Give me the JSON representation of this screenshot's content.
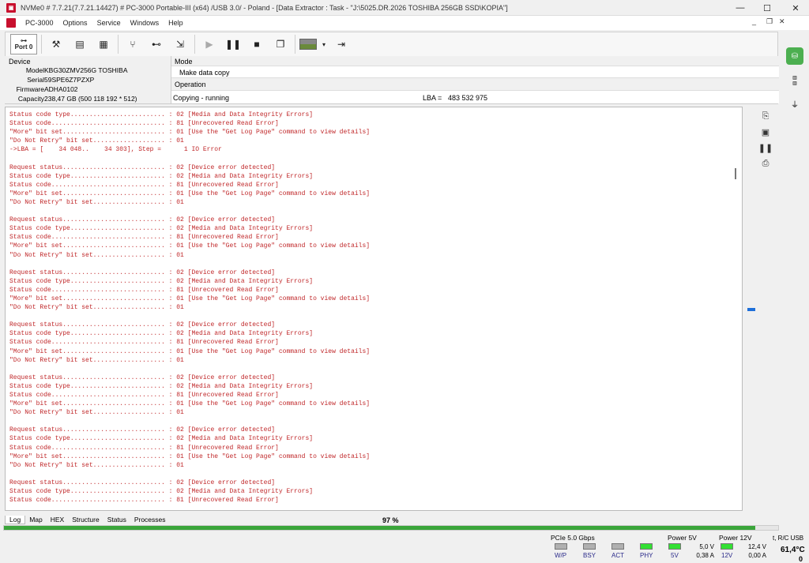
{
  "window": {
    "title": "NVMe0 # 7.7.21(7.7.21.14427) # PC-3000 Portable-III (x64) /USB 3.0/ - Poland - [Data Extractor : Task - \"J:\\5025.DR.2026 TOSHIBA 256GB SSD\\KOPIA\"]",
    "min": "—",
    "max": "☐",
    "close": "✕"
  },
  "menu": [
    "PC-3000",
    "Options",
    "Service",
    "Windows",
    "Help"
  ],
  "mdi": {
    "min": "_",
    "restore": "❐",
    "close": "✕"
  },
  "toolbar": {
    "port_label": "Port 0"
  },
  "device": {
    "heading": "Device",
    "rows": [
      {
        "label": "Model",
        "value": "KBG30ZMV256G TOSHIBA"
      },
      {
        "label": "Serial",
        "value": "59SPE6Z7PZXP"
      },
      {
        "label": "Firmware",
        "value": "ADHA0102"
      },
      {
        "label": "Capacity",
        "value": "238,47 GB (500 118 192 * 512)"
      }
    ]
  },
  "mode": {
    "heading": "Mode",
    "value": "Make data copy"
  },
  "operation": {
    "heading": "Operation",
    "value": "Copying - running",
    "lba_label": "LBA =",
    "lba_value": "483 532 975"
  },
  "log": {
    "lines": [
      "Status code type......................... : 02 [Media and Data Integrity Errors]",
      "Status code.............................. : 81 [Unrecovered Read Error]",
      "\"More\" bit set........................... : 01 [Use the \"Get Log Page\" command to view details]",
      "\"Do Not Retry\" bit set................... : 01",
      "->LBA = [    34 048..    34 303], Step =      1 IO Error",
      "",
      "Request status........................... : 02 [Device error detected]",
      "Status code type......................... : 02 [Media and Data Integrity Errors]",
      "Status code.............................. : 81 [Unrecovered Read Error]",
      "\"More\" bit set........................... : 01 [Use the \"Get Log Page\" command to view details]",
      "\"Do Not Retry\" bit set................... : 01",
      "",
      "Request status........................... : 02 [Device error detected]",
      "Status code type......................... : 02 [Media and Data Integrity Errors]",
      "Status code.............................. : 81 [Unrecovered Read Error]",
      "\"More\" bit set........................... : 01 [Use the \"Get Log Page\" command to view details]",
      "\"Do Not Retry\" bit set................... : 01",
      "",
      "Request status........................... : 02 [Device error detected]",
      "Status code type......................... : 02 [Media and Data Integrity Errors]",
      "Status code.............................. : 81 [Unrecovered Read Error]",
      "\"More\" bit set........................... : 01 [Use the \"Get Log Page\" command to view details]",
      "\"Do Not Retry\" bit set................... : 01",
      "",
      "Request status........................... : 02 [Device error detected]",
      "Status code type......................... : 02 [Media and Data Integrity Errors]",
      "Status code.............................. : 81 [Unrecovered Read Error]",
      "\"More\" bit set........................... : 01 [Use the \"Get Log Page\" command to view details]",
      "\"Do Not Retry\" bit set................... : 01",
      "",
      "Request status........................... : 02 [Device error detected]",
      "Status code type......................... : 02 [Media and Data Integrity Errors]",
      "Status code.............................. : 81 [Unrecovered Read Error]",
      "\"More\" bit set........................... : 01 [Use the \"Get Log Page\" command to view details]",
      "\"Do Not Retry\" bit set................... : 01",
      "",
      "Request status........................... : 02 [Device error detected]",
      "Status code type......................... : 02 [Media and Data Integrity Errors]",
      "Status code.............................. : 81 [Unrecovered Read Error]",
      "\"More\" bit set........................... : 01 [Use the \"Get Log Page\" command to view details]",
      "\"Do Not Retry\" bit set................... : 01",
      "",
      "Request status........................... : 02 [Device error detected]",
      "Status code type......................... : 02 [Media and Data Integrity Errors]",
      "Status code.............................. : 81 [Unrecovered Read Error]"
    ]
  },
  "tabs": [
    "Log",
    "Map",
    "HEX",
    "Structure",
    "Status",
    "Processes"
  ],
  "progress": {
    "label": "97 %",
    "fraction": 0.97
  },
  "status": {
    "pcie_label": "PCIe 5.0 Gbps",
    "leds": [
      {
        "label": "W/P",
        "on": false
      },
      {
        "label": "BSY",
        "on": false
      },
      {
        "label": "ACT",
        "on": false
      },
      {
        "label": "PHY",
        "on": true
      }
    ],
    "power5": {
      "heading": "Power 5V",
      "led": "5V",
      "volt": "5,0 V",
      "amp": "0,38 A"
    },
    "power12": {
      "heading": "Power 12V",
      "led": "12V",
      "volt": "12,4 V",
      "amp": "0,00 A"
    },
    "usb": {
      "heading": "t, R/C USB",
      "temp": "61,4°C",
      "count": "0"
    }
  },
  "colors": {
    "log_text": "#c0282a",
    "progress": "#3aa53a",
    "led_on": "#33e033",
    "led_off": "#b0b0b0",
    "marker": "#1e6fd9"
  }
}
